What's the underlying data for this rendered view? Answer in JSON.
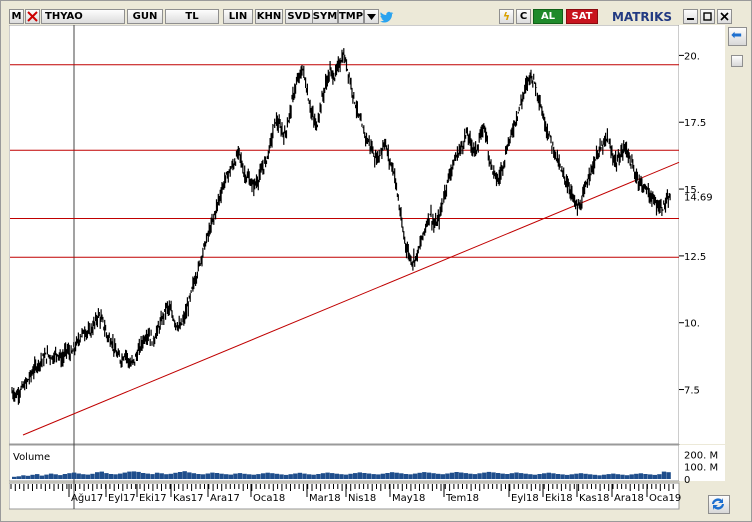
{
  "toolbar": {
    "menu_label": "M",
    "symbol": "THYAO",
    "period": "GUN",
    "currency": "TL",
    "scale": "LIN",
    "khn": "KHN",
    "svd": "SVD",
    "sym": "SYM",
    "tmp": "TMP",
    "refresh_glyph": "ς",
    "c_label": "C",
    "buy_label": "AL",
    "sell_label": "SAT",
    "brand": "MATRIKS"
  },
  "chart_data": {
    "type": "candlestick",
    "symbol": "THYAO",
    "yaxis_ticks": [
      "20.",
      "17.5",
      "15.",
      "12.5",
      "10.",
      "7.5"
    ],
    "yaxis_tick_values": [
      20,
      17.5,
      15,
      12.5,
      10,
      7.5
    ],
    "last_price_label": "14.69",
    "last_price": 14.69,
    "ylim": [
      5.5,
      21.1
    ],
    "xaxis_labels": [
      "Ağu17",
      "Eyl17",
      "Eki17",
      "Kas17",
      "Ara17",
      "Oca18",
      "Mar18",
      "Nis18",
      "May18",
      "Tem18",
      "Eyl18",
      "Eki18",
      "Kas18",
      "Ara18",
      "Oca19"
    ],
    "horizontal_lines": [
      19.65,
      16.45,
      13.9,
      12.45
    ],
    "trendline": {
      "start": 5.8,
      "end": 16.0
    },
    "colors": {
      "price": "#000000",
      "lines": "#c00000",
      "volume": "#1f4e8c"
    },
    "price_path": [
      7.4,
      7.3,
      7.5,
      7.7,
      8.0,
      8.3,
      8.5,
      8.7,
      8.8,
      8.7,
      8.9,
      8.6,
      9.0,
      8.8,
      9.1,
      9.5,
      9.7,
      9.6,
      9.9,
      10.3,
      10.0,
      9.5,
      9.3,
      8.8,
      8.6,
      8.9,
      8.4,
      8.6,
      9.0,
      9.4,
      9.6,
      9.3,
      9.7,
      10.1,
      10.6,
      10.4,
      10.0,
      9.8,
      10.2,
      10.8,
      11.5,
      12.0,
      12.7,
      13.2,
      13.7,
      14.3,
      14.9,
      15.4,
      15.7,
      16.0,
      16.4,
      15.6,
      15.4,
      15.1,
      15.3,
      15.7,
      16.1,
      16.8,
      17.6,
      17.3,
      17.0,
      17.7,
      18.6,
      19.1,
      19.5,
      18.6,
      17.8,
      17.3,
      18.2,
      18.9,
      19.4,
      19.2,
      19.7,
      20.0,
      19.4,
      18.6,
      17.9,
      17.3,
      16.9,
      16.6,
      16.1,
      16.3,
      16.8,
      16.1,
      15.7,
      14.6,
      13.4,
      12.7,
      12.3,
      12.5,
      13.0,
      13.6,
      14.1,
      13.6,
      13.9,
      14.7,
      15.4,
      15.9,
      16.3,
      16.6,
      17.1,
      16.7,
      16.4,
      16.9,
      17.4,
      16.2,
      15.6,
      15.3,
      15.9,
      16.6,
      17.1,
      17.7,
      18.2,
      18.8,
      19.3,
      19.0,
      18.4,
      17.6,
      17.1,
      16.6,
      16.1,
      15.6,
      15.3,
      14.9,
      14.4,
      14.3,
      14.9,
      15.6,
      15.9,
      16.4,
      16.6,
      16.9,
      16.3,
      16.0,
      16.3,
      16.6,
      16.1,
      15.6,
      15.3,
      15.1,
      14.9,
      14.6,
      14.4,
      14.3,
      14.5,
      14.69
    ],
    "volume_axis_labels": [
      "200. M",
      "100. M",
      "0"
    ],
    "volume_axis_values": [
      200,
      100,
      0
    ],
    "volume_label": "Volume",
    "volume_unit": "M",
    "volume": [
      18,
      22,
      30,
      26,
      34,
      40,
      28,
      36,
      44,
      38,
      32,
      41,
      47,
      52,
      45,
      39,
      36,
      42,
      55,
      60,
      48,
      41,
      38,
      44,
      52,
      60,
      62,
      58,
      49,
      44,
      40,
      51,
      46,
      39,
      42,
      50,
      57,
      63,
      54,
      47,
      41,
      38,
      45,
      52,
      49,
      43,
      39,
      36,
      44,
      48,
      42,
      38,
      35,
      40,
      46,
      51,
      47,
      42,
      37,
      33,
      39,
      45,
      50,
      44,
      38,
      35,
      41,
      47,
      52,
      48,
      43,
      39,
      36,
      42,
      48,
      54,
      49,
      45,
      40,
      37,
      43,
      49,
      55,
      51,
      46,
      41,
      38,
      44,
      50,
      56,
      52,
      47,
      42,
      39,
      45,
      51,
      57,
      53,
      48,
      43,
      40,
      46,
      52,
      58,
      54,
      49,
      44,
      41,
      47,
      53,
      48,
      43,
      39,
      35,
      41,
      46,
      51,
      46,
      41,
      37,
      33,
      38,
      43,
      47,
      42,
      38,
      34,
      30,
      35,
      40,
      44,
      39,
      35,
      31,
      37,
      42,
      46,
      41,
      37,
      33,
      39,
      60,
      55
    ]
  },
  "sidebar": {
    "arrow_glyph": "⬅"
  }
}
